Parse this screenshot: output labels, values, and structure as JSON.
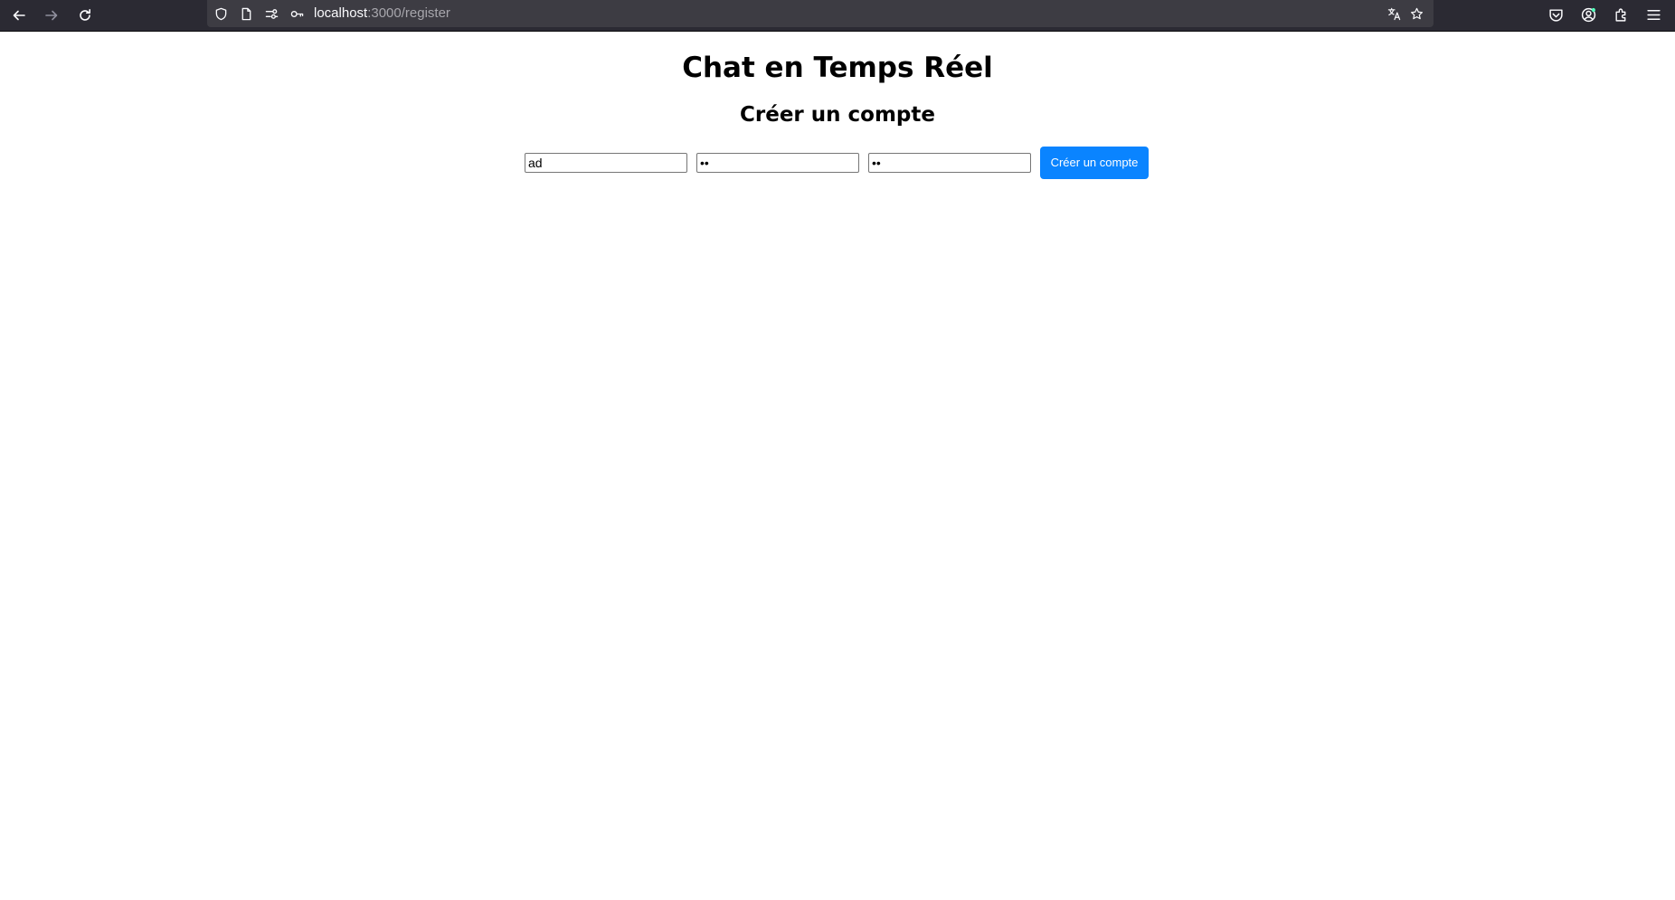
{
  "browser": {
    "url_host": "localhost",
    "url_path": ":3000/register",
    "icons": {
      "back": "back-arrow-icon",
      "forward": "forward-arrow-icon",
      "reload": "reload-icon",
      "shield": "shield-icon",
      "page": "page-icon",
      "permissions": "permissions-icon",
      "key": "key-icon",
      "translate": "translate-icon",
      "bookmark": "star-icon",
      "pocket": "pocket-icon",
      "account": "account-icon",
      "extensions": "puzzle-icon",
      "menu": "hamburger-menu-icon"
    },
    "colors": {
      "toolbar_bg": "#2b2a33",
      "urlbar_bg": "#3d3c43",
      "account_badge": "#54ffbd"
    }
  },
  "page": {
    "title": "Chat en Temps Réel",
    "subtitle": "Créer un compte"
  },
  "form": {
    "username_value": "ad",
    "password_value": "••",
    "confirm_password_value": "••",
    "submit_label": "Créer un compte",
    "submit_color": "#0a84ff"
  }
}
